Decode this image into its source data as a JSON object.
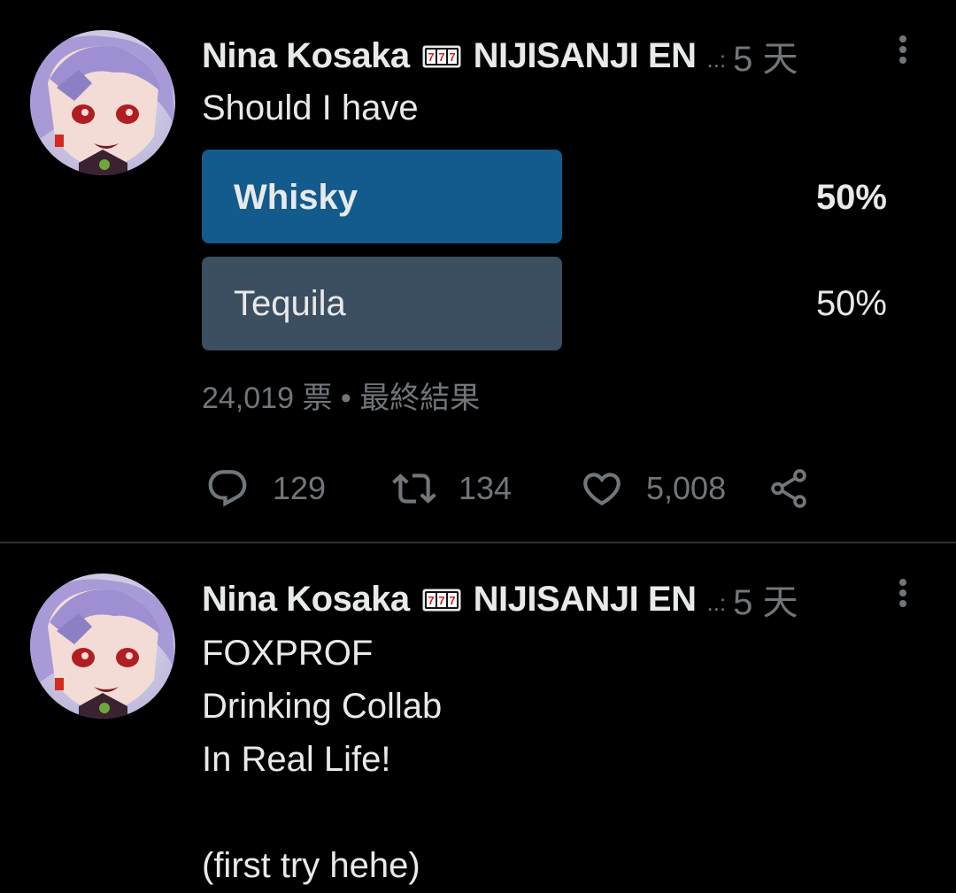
{
  "colors": {
    "background": "#000000",
    "text": "#e7e9ea",
    "muted": "#71767b",
    "winning_bar": "#135b8c",
    "losing_bar": "#3c4f60",
    "divider": "#2f3336"
  },
  "tweets": [
    {
      "author": {
        "display_name": "Nina Kosaka",
        "badge_icon": "slot-machine-777-emoji",
        "affiliation": "NIJISANJI EN",
        "ellipsis": "..:",
        "timestamp": "5 天"
      },
      "text": "Should I have",
      "poll": {
        "options": [
          {
            "label": "Whisky",
            "percent": "50%",
            "winner": true,
            "fill_fraction": 1.0
          },
          {
            "label": "Tequila",
            "percent": "50%",
            "winner": false,
            "fill_fraction": 1.0
          }
        ],
        "votes": "24,019 票",
        "separator": "•",
        "status": "最終結果"
      },
      "actions": {
        "reply": {
          "icon": "reply-icon",
          "count": "129"
        },
        "retweet": {
          "icon": "retweet-icon",
          "count": "134"
        },
        "like": {
          "icon": "heart-icon",
          "count": "5,008"
        },
        "share": {
          "icon": "share-icon"
        }
      }
    },
    {
      "author": {
        "display_name": "Nina Kosaka",
        "badge_icon": "slot-machine-777-emoji",
        "affiliation": "NIJISANJI EN",
        "ellipsis": "..:",
        "timestamp": "5 天"
      },
      "text": "FOXPROF\nDrinking Collab\nIn Real Life!\n\n(first try hehe)"
    }
  ]
}
